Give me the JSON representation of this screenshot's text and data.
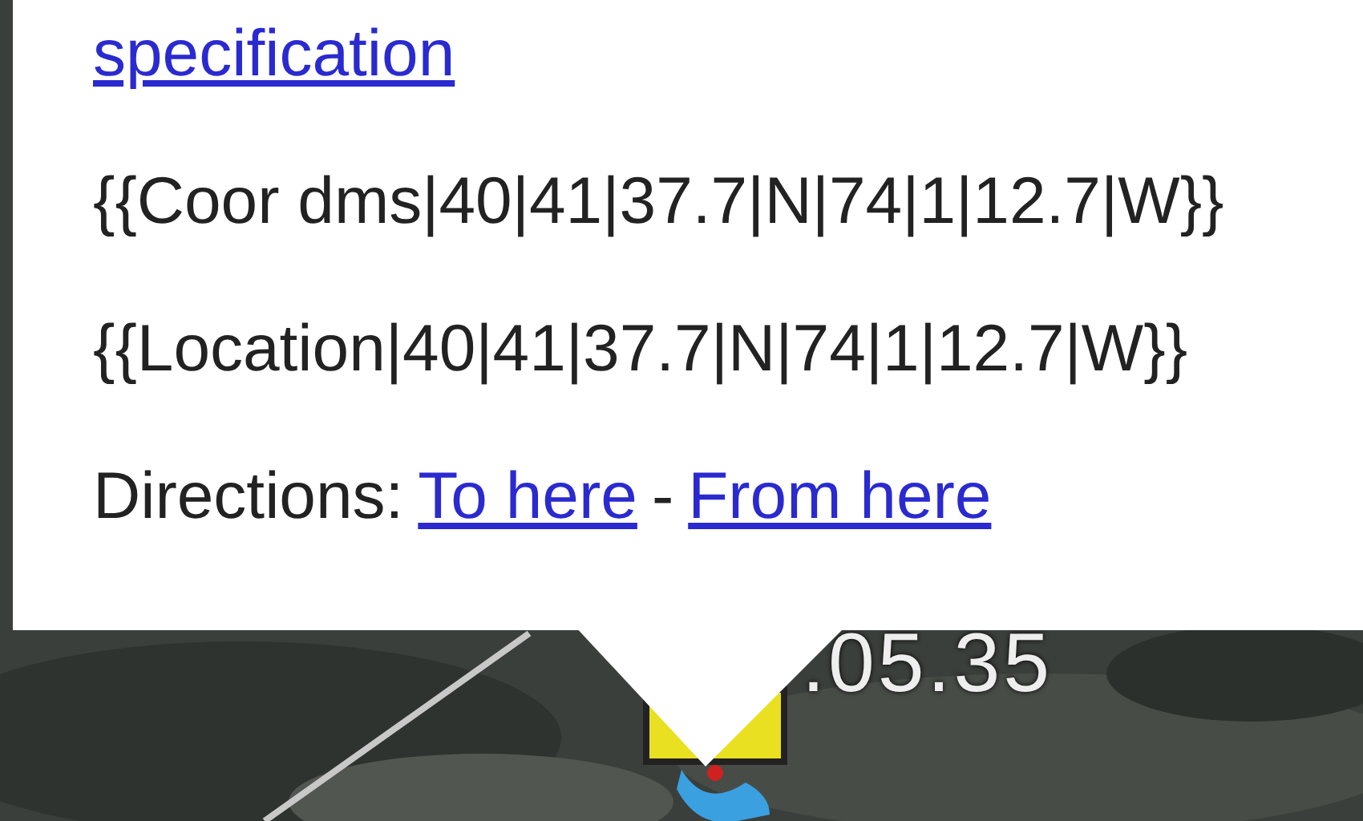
{
  "balloon": {
    "lines": [
      {
        "kind": "link",
        "text": "specification"
      },
      {
        "kind": "text",
        "text": "{{Coor dms|40|41|37.7|N|74|1|12.7|W}}"
      },
      {
        "kind": "text",
        "text": "{{Location|40|41|37.7|N|74|1|12.7|W}}"
      },
      {
        "kind": "directions",
        "label": "Directions:",
        "links": [
          "To here",
          "From here"
        ],
        "separator": "-"
      }
    ]
  },
  "map": {
    "placemark_label": ".05.35"
  }
}
